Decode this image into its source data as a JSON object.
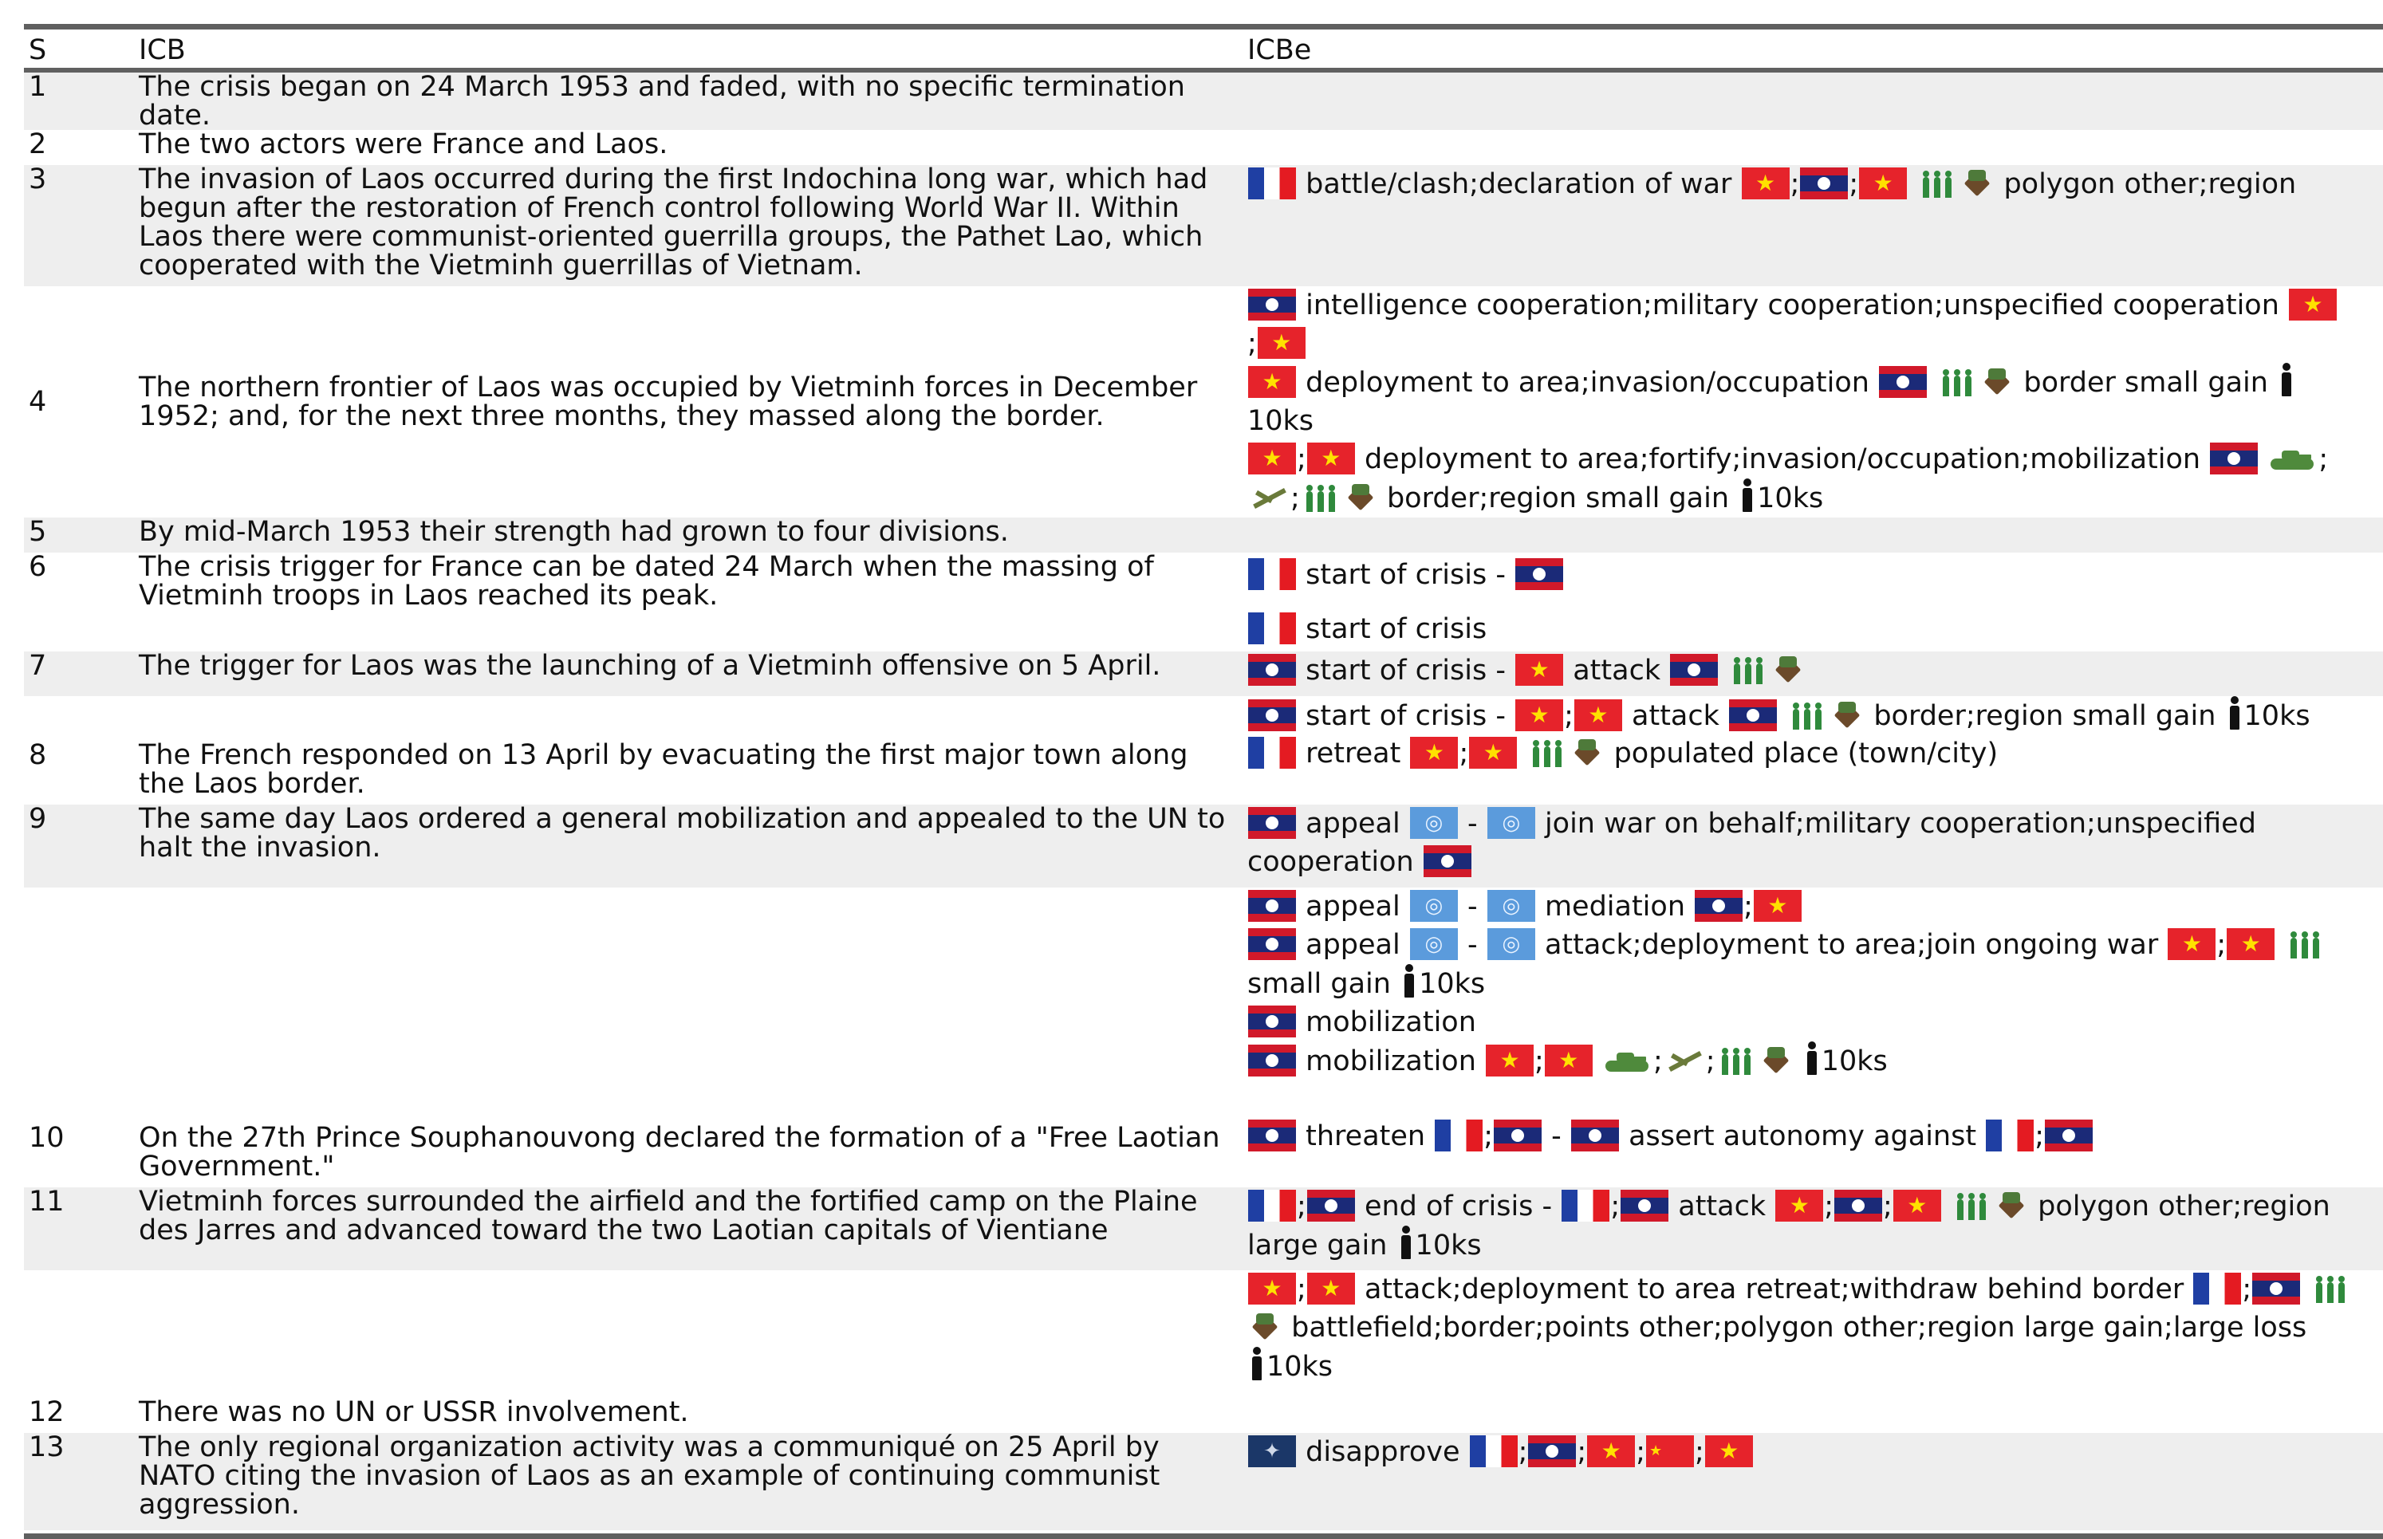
{
  "headers": {
    "s": "S",
    "icb": "ICB",
    "icbe": "ICBe"
  },
  "rows": [
    {
      "s": "1",
      "icb": "The crisis began on 24 March 1953 and faded, with no specific termination date."
    },
    {
      "s": "2",
      "icb": "The two actors were France and Laos."
    },
    {
      "s": "3",
      "icb": "The invasion of Laos occurred during the first Indochina long war, which had begun after the restoration of French control following World War II. Within Laos there were communist-oriented guerrilla groups, the Pathet Lao, which cooperated with the Vietminh guerrillas of Vietnam.",
      "e1": "battle/clash;declaration of war",
      "e2": "polygon other;region"
    },
    {
      "s": "4",
      "icb": "The northern frontier of Laos was occupied by Vietminh forces in December 1952; and, for the next three months, they massed along the border.",
      "e1": "intelligence cooperation;military cooperation;unspecified cooperation",
      "e2": "deployment to area;invasion/occupation",
      "e3": "border small gain",
      "e4": "10ks",
      "e5": "deployment to area;fortify;invasion/occupation;mobilization",
      "e6": "border;region small gain",
      "e7": "10ks"
    },
    {
      "s": "5",
      "icb": "By mid-March 1953 their strength had grown to four divisions."
    },
    {
      "s": "6",
      "icb": "The crisis trigger for France can be dated 24 March when the massing of Vietminh troops in Laos reached its peak.",
      "e1": "start of crisis -",
      "e2": "start of crisis"
    },
    {
      "s": "7",
      "icb": "The trigger for Laos was the launching of a Vietminh offensive on 5 April.",
      "e1": "start of crisis -",
      "e2": "attack",
      "e3": "start of crisis -",
      "e4": "attack",
      "e5": "border;region small gain",
      "e6": "10ks"
    },
    {
      "s": "8",
      "icb": "The French responded on 13 April by evacuating the first major town along the Laos border.",
      "e1": "retreat",
      "e2": "populated place (town/city)"
    },
    {
      "s": "9",
      "icb": "The same day Laos ordered a general mobilization and appealed to the UN to halt the invasion.",
      "e1": "appeal",
      "e2": "join war on behalf;military cooperation;unspecified cooperation",
      "e3": "appeal",
      "e4": "mediation",
      "e5": "appeal",
      "e6": "attack;deployment to area;join ongoing war",
      "e7": "small gain",
      "e8": "10ks",
      "e9": "mobilization",
      "e10": "mobilization",
      "e11": "10ks"
    },
    {
      "s": "10",
      "icb": "On the 27th Prince Souphanouvong declared the formation of a \"Free Laotian Government.\"",
      "e1": "threaten",
      "e2": "assert autonomy against"
    },
    {
      "s": "11",
      "icb": "Vietminh forces surrounded the airfield and the fortified camp on the Plaine des Jarres and advanced toward the two Laotian capitals of Vientiane",
      "e1": "end of crisis -",
      "e2": "attack",
      "e3": "polygon other;region",
      "e4": "large gain",
      "e5": "10ks",
      "e6": "attack;deployment to area retreat;withdraw behind border",
      "e7": "battlefield;border;points other;polygon other;region large gain;large loss",
      "e8": "10ks"
    },
    {
      "s": "12",
      "icb": "There was no UN or USSR involvement."
    },
    {
      "s": "13",
      "icb": "The only regional organization activity was a communiqué on 25 April by NATO citing the invasion of Laos as an example of continuing communist aggression.",
      "e1": "disapprove"
    }
  ],
  "sep": {
    "semi": ";",
    "dash": "-"
  },
  "colors": {
    "rule": "#606060",
    "band": "#eeeeee"
  }
}
